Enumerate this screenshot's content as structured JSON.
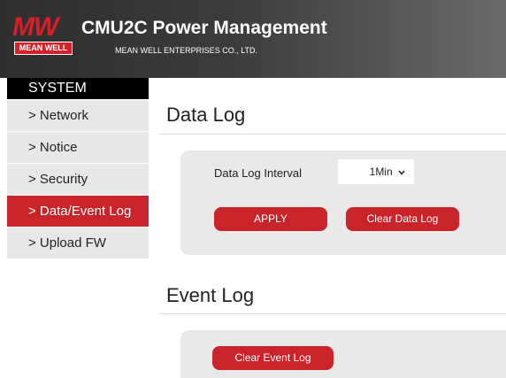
{
  "header": {
    "logo_text": "MW",
    "logo_box_text": "MEAN WELL",
    "title": "CMU2C Power Management",
    "subtitle": "MEAN WELL ENTERPRISES CO., LTD."
  },
  "sidebar": {
    "heading": "SYSTEM",
    "items": [
      {
        "label": "> Network"
      },
      {
        "label": "> Notice"
      },
      {
        "label": "> Security"
      },
      {
        "label": "> Data/Event Log"
      },
      {
        "label": "> Upload FW"
      }
    ],
    "active_index": 3
  },
  "data_log": {
    "title": "Data Log",
    "interval_label": "Data Log Interval",
    "interval_value": "1Min",
    "apply_label": "APPLY",
    "clear_label": "Clear Data Log"
  },
  "event_log": {
    "title": "Event Log",
    "clear_label": "Clear Event Log"
  },
  "colors": {
    "brand_red": "#c8242a",
    "header_dark": "#2e2e2e",
    "panel_gray": "#e9e9e9"
  }
}
